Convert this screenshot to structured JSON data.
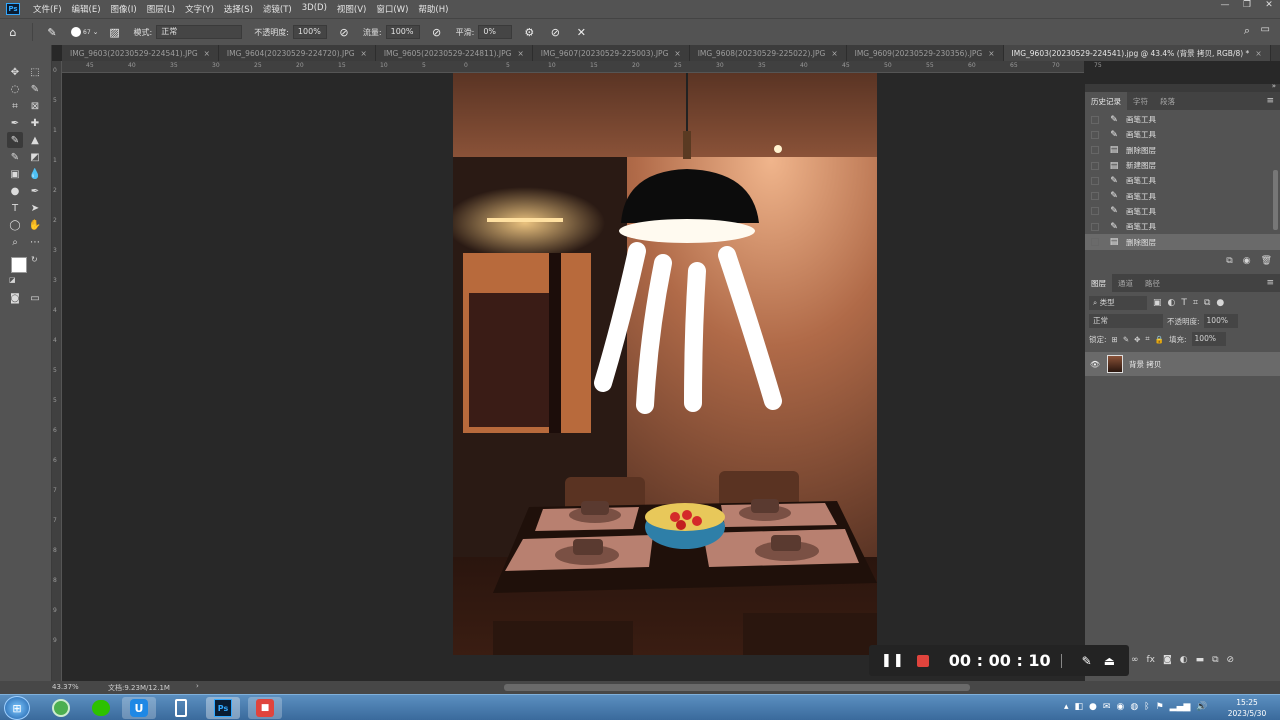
{
  "menu": [
    "文件(F)",
    "编辑(E)",
    "图像(I)",
    "图层(L)",
    "文字(Y)",
    "选择(S)",
    "滤镜(T)",
    "3D(D)",
    "视图(V)",
    "窗口(W)",
    "帮助(H)"
  ],
  "options": {
    "brush_size": "67",
    "mode_label": "模式:",
    "mode_value": "正常",
    "opacity_label": "不透明度:",
    "opacity_value": "100%",
    "flow_label": "流量:",
    "flow_value": "100%",
    "smooth_label": "平滑:",
    "smooth_value": "0%"
  },
  "tabs": [
    {
      "label": "IMG_9603(20230529-224541).JPG",
      "active": false
    },
    {
      "label": "IMG_9604(20230529-224720).JPG",
      "active": false
    },
    {
      "label": "IMG_9605(20230529-224811).JPG",
      "active": false
    },
    {
      "label": "IMG_9607(20230529-225003).JPG",
      "active": false
    },
    {
      "label": "IMG_9608(20230529-225022).JPG",
      "active": false
    },
    {
      "label": "IMG_9609(20230529-230356).JPG",
      "active": false
    },
    {
      "label": "IMG_9603(20230529-224541).jpg @ 43.4% (背景 拷贝, RGB/8) *",
      "active": true
    }
  ],
  "ruler_top_ticks": [
    "45",
    "40",
    "35",
    "30",
    "25",
    "20",
    "15",
    "10",
    "5",
    "0",
    "5",
    "10",
    "15",
    "20",
    "25",
    "30",
    "35",
    "40",
    "45",
    "50",
    "55",
    "60",
    "65",
    "70",
    "75"
  ],
  "ruler_left_ticks": [
    "0",
    "5",
    "1",
    "1",
    "2",
    "2",
    "3",
    "3",
    "4",
    "4",
    "5",
    "5",
    "6",
    "6",
    "7",
    "7",
    "8",
    "8",
    "9",
    "9"
  ],
  "history": {
    "tabs": [
      "历史记录",
      "字符",
      "段落"
    ],
    "items": [
      {
        "label": "画笔工具",
        "icon": "brush-icon"
      },
      {
        "label": "画笔工具",
        "icon": "brush-icon"
      },
      {
        "label": "删除图层",
        "icon": "document-icon"
      },
      {
        "label": "新建图层",
        "icon": "document-icon"
      },
      {
        "label": "画笔工具",
        "icon": "brush-icon"
      },
      {
        "label": "画笔工具",
        "icon": "brush-icon"
      },
      {
        "label": "画笔工具",
        "icon": "brush-icon"
      },
      {
        "label": "画笔工具",
        "icon": "brush-icon"
      },
      {
        "label": "删除图层",
        "icon": "document-icon"
      }
    ]
  },
  "layers": {
    "tabs": [
      "图层",
      "通道",
      "路径"
    ],
    "filter_label": "类型",
    "blend_mode": "正常",
    "opacity_label": "不透明度:",
    "opacity_value": "100%",
    "lock_label": "锁定:",
    "fill_label": "填充:",
    "fill_value": "100%",
    "items": [
      {
        "name": "背景 拷贝",
        "visible": true
      }
    ]
  },
  "status": {
    "zoom": "43.37%",
    "doc": "文档:9.23M/12.1M"
  },
  "recorder": {
    "time": "00 : 00 : 10"
  },
  "taskbar": {
    "time": "15:25",
    "date": "2023/5/30"
  },
  "colors": {
    "accent": "#31a8ff",
    "record_red": "#e0443d",
    "panel_bg": "#535353",
    "canvas_bg": "#282828"
  }
}
